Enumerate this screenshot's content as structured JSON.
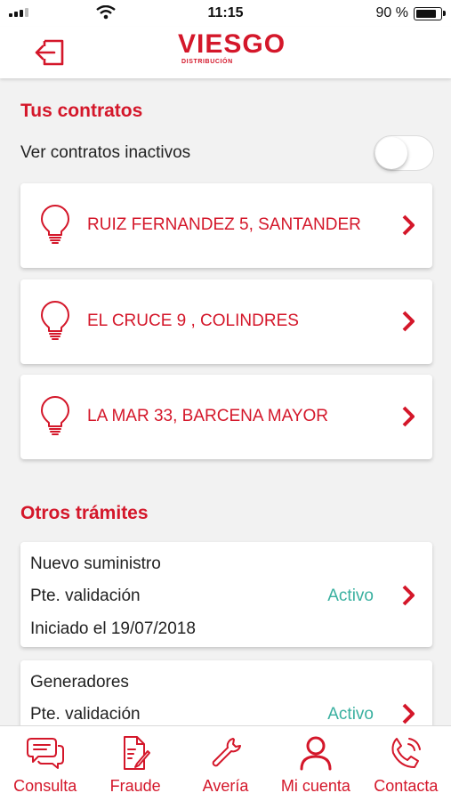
{
  "status_bar": {
    "time": "11:15",
    "battery": "90 %"
  },
  "header": {
    "brand": "VIESGO",
    "brand_sub": "DISTRIBUCIÓN"
  },
  "contracts": {
    "title": "Tus contratos",
    "toggle_label": "Ver contratos inactivos",
    "toggle_on": false,
    "items": [
      {
        "address": "RUIZ FERNANDEZ 5, SANTANDER"
      },
      {
        "address": "EL CRUCE 9 , COLINDRES"
      },
      {
        "address": "LA MAR 33, BARCENA MAYOR"
      }
    ]
  },
  "procedures": {
    "title": "Otros trámites",
    "items": [
      {
        "name": "Nuevo suministro",
        "state": "Pte. validación",
        "status": "Activo",
        "started": "Iniciado el 19/07/2018"
      },
      {
        "name": "Generadores",
        "state": "Pte. validación",
        "status": "Activo"
      }
    ]
  },
  "tabs": [
    {
      "label": "Consulta",
      "icon": "chat-icon"
    },
    {
      "label": "Fraude",
      "icon": "document-edit-icon"
    },
    {
      "label": "Avería",
      "icon": "wrench-icon"
    },
    {
      "label": "Mi cuenta",
      "icon": "user-icon"
    },
    {
      "label": "Contacta",
      "icon": "phone-icon"
    }
  ],
  "colors": {
    "brand": "#d4172a",
    "active": "#3ab0a0"
  }
}
